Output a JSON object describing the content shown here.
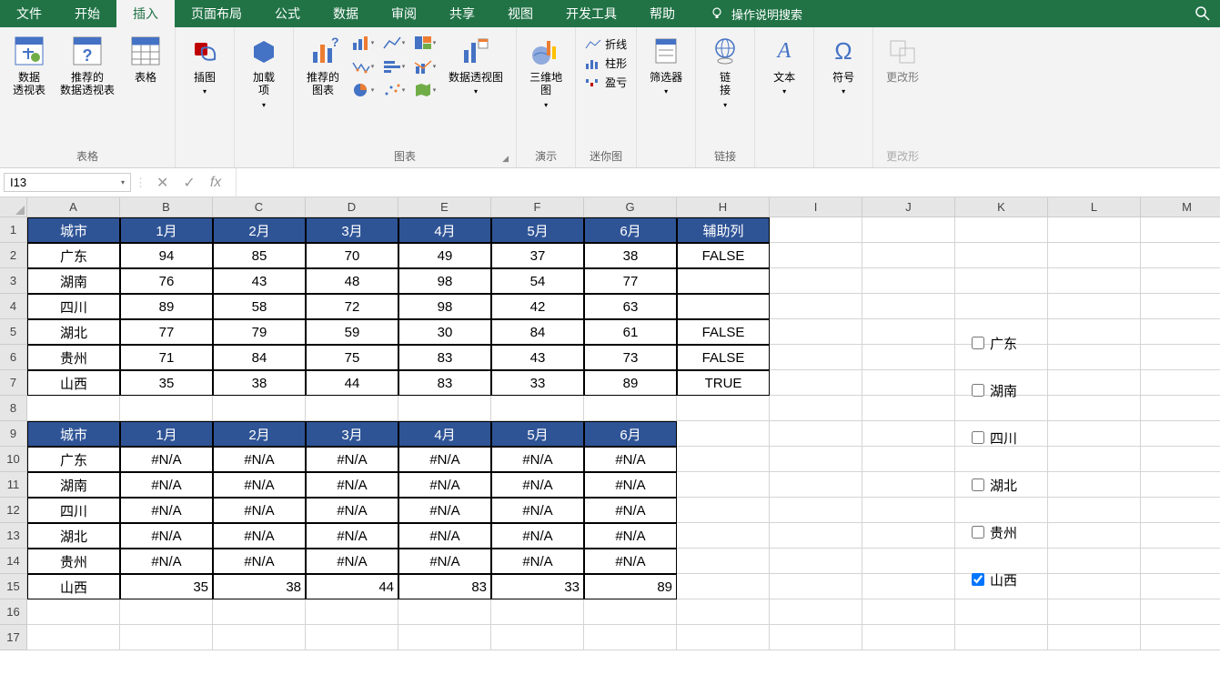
{
  "menubar": {
    "tabs": [
      "文件",
      "开始",
      "插入",
      "页面布局",
      "公式",
      "数据",
      "审阅",
      "共享",
      "视图",
      "开发工具",
      "帮助"
    ],
    "active": 2,
    "tell_me": "操作说明搜索"
  },
  "ribbon": {
    "group_tables": {
      "label": "表格",
      "pivot": "数据\n透视表",
      "rec_pivot": "推荐的\n数据透视表",
      "table": "表格"
    },
    "group_illust": {
      "label": "",
      "btn": "插图"
    },
    "group_addin": {
      "label": "",
      "btn": "加载\n项"
    },
    "group_charts": {
      "label": "图表",
      "rec_chart": "推荐的\n图表",
      "pivot_chart": "数据透视图",
      "map3d": "三维地\n图"
    },
    "group_tour": {
      "label": "演示"
    },
    "group_spark": {
      "label": "迷你图",
      "line": "折线",
      "column": "柱形",
      "winloss": "盈亏"
    },
    "group_filter": {
      "label": "",
      "btn": "筛选器"
    },
    "group_link": {
      "label": "链接",
      "btn": "链\n接"
    },
    "group_text": {
      "label": "",
      "btn": "文本"
    },
    "group_symbol": {
      "label": "",
      "btn": "符号"
    },
    "group_shape": {
      "label": "更改形",
      "btn": "更改形"
    }
  },
  "name_box": "I13",
  "formula": "",
  "columns": [
    "A",
    "B",
    "C",
    "D",
    "E",
    "F",
    "G",
    "H",
    "I",
    "J",
    "K",
    "L",
    "M"
  ],
  "row_count": 17,
  "table1": {
    "headers": [
      "城市",
      "1月",
      "2月",
      "3月",
      "4月",
      "5月",
      "6月",
      "辅助列"
    ],
    "rows": [
      [
        "广东",
        "94",
        "85",
        "70",
        "49",
        "37",
        "38",
        "FALSE"
      ],
      [
        "湖南",
        "76",
        "43",
        "48",
        "98",
        "54",
        "77",
        ""
      ],
      [
        "四川",
        "89",
        "58",
        "72",
        "98",
        "42",
        "63",
        ""
      ],
      [
        "湖北",
        "77",
        "79",
        "59",
        "30",
        "84",
        "61",
        "FALSE"
      ],
      [
        "贵州",
        "71",
        "84",
        "75",
        "83",
        "43",
        "73",
        "FALSE"
      ],
      [
        "山西",
        "35",
        "38",
        "44",
        "83",
        "33",
        "89",
        "TRUE"
      ]
    ]
  },
  "table2": {
    "headers": [
      "城市",
      "1月",
      "2月",
      "3月",
      "4月",
      "5月",
      "6月"
    ],
    "rows": [
      [
        "广东",
        "#N/A",
        "#N/A",
        "#N/A",
        "#N/A",
        "#N/A",
        "#N/A"
      ],
      [
        "湖南",
        "#N/A",
        "#N/A",
        "#N/A",
        "#N/A",
        "#N/A",
        "#N/A"
      ],
      [
        "四川",
        "#N/A",
        "#N/A",
        "#N/A",
        "#N/A",
        "#N/A",
        "#N/A"
      ],
      [
        "湖北",
        "#N/A",
        "#N/A",
        "#N/A",
        "#N/A",
        "#N/A",
        "#N/A"
      ],
      [
        "贵州",
        "#N/A",
        "#N/A",
        "#N/A",
        "#N/A",
        "#N/A",
        "#N/A"
      ],
      [
        "山西",
        "35",
        "38",
        "44",
        "83",
        "33",
        "89"
      ]
    ]
  },
  "checks": [
    {
      "label": "广东",
      "checked": false
    },
    {
      "label": "湖南",
      "checked": false
    },
    {
      "label": "四川",
      "checked": false
    },
    {
      "label": "湖北",
      "checked": false
    },
    {
      "label": "贵州",
      "checked": false
    },
    {
      "label": "山西",
      "checked": true
    }
  ]
}
